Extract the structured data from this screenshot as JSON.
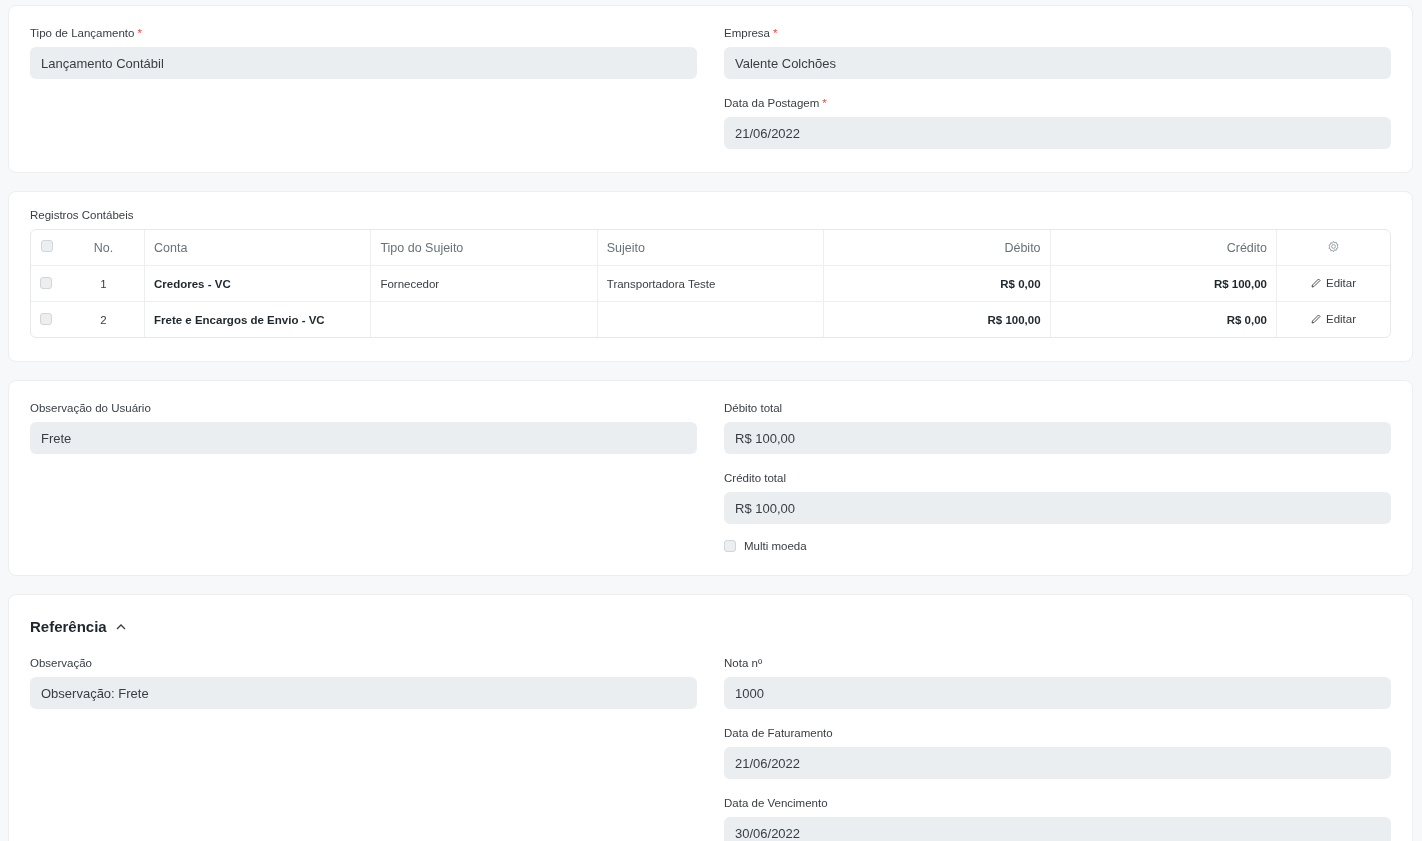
{
  "sections": [
    {
      "kind": "form",
      "left": [
        {
          "label": "Tipo de Lançamento",
          "required_mark": "*",
          "value": "Lançamento Contábil"
        }
      ],
      "right": [
        {
          "label": "Empresa",
          "required_mark": "*",
          "value": "Valente Colchões"
        },
        {
          "label": "Data da Postagem",
          "required_mark": "*",
          "value": "21/06/2022"
        }
      ]
    },
    {
      "kind": "table",
      "title": "Registros Contábeis",
      "table": {
        "header_checked": false,
        "columns": [
          {
            "label": "No."
          },
          {
            "label": "Conta"
          },
          {
            "label": "Tipo do Sujeito"
          },
          {
            "label": "Sujeito"
          },
          {
            "label": "Débito"
          },
          {
            "label": "Crédito"
          }
        ],
        "rows": [
          {
            "checked": false,
            "cells": [
              "1",
              "Credores - VC",
              "Fornecedor",
              "Transportadora Teste",
              "R$ 0,00",
              "R$ 100,00"
            ],
            "action": "Editar"
          },
          {
            "checked": false,
            "cells": [
              "2",
              "Frete e Encargos de Envio - VC",
              "",
              "",
              "R$ 100,00",
              "R$ 0,00"
            ],
            "action": "Editar"
          }
        ]
      }
    },
    {
      "kind": "form",
      "left": [
        {
          "label": "Observação do Usuário",
          "value": "Frete"
        }
      ],
      "right": [
        {
          "label": "Débito total",
          "value": "R$ 100,00"
        },
        {
          "label": "Crédito total",
          "value": "R$ 100,00"
        }
      ],
      "checkbox": {
        "label": "Multi moeda",
        "checked": false
      }
    },
    {
      "kind": "form",
      "heading": "Referência",
      "expanded": true,
      "left": [
        {
          "label": "Observação",
          "value": "Observação: Frete"
        }
      ],
      "right": [
        {
          "label": "Nota nº",
          "value": "1000"
        },
        {
          "label": "Data de Faturamento",
          "value": "21/06/2022"
        },
        {
          "label": "Data de Vencimento",
          "value": "30/06/2022"
        }
      ]
    }
  ]
}
